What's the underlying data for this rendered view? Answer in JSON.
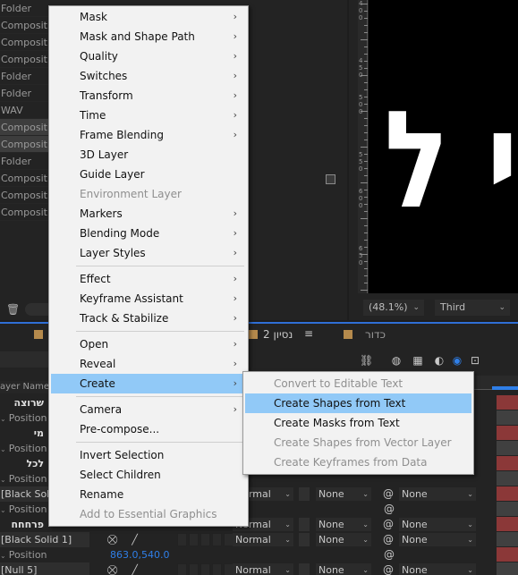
{
  "project": {
    "items": [
      "Folder",
      "Compositio",
      "Compositio",
      "Compositio",
      "Folder",
      "Folder",
      "WAV",
      "Compositio",
      "Compositio",
      "Folder",
      "Compositio",
      "Compositio",
      "Compositio"
    ]
  },
  "viewer": {
    "zoom": "(48.1%)",
    "resolution": "Third",
    "comp_text": "י ל",
    "ruler_numbers": [
      "4",
      "0",
      "0",
      "4",
      "5",
      "0",
      "5",
      "0",
      "0",
      "5",
      "5",
      "0",
      "6",
      "0",
      "0",
      "6",
      "5",
      "0"
    ]
  },
  "timeline": {
    "tabs": [
      "2 נסיון",
      "כדור"
    ],
    "tab_menu": "≡",
    "column_header": "ayer Name",
    "layers": [
      {
        "name": "שרוצה",
        "kind": "text"
      },
      {
        "name": "Position",
        "kind": "prop"
      },
      {
        "name": "מי",
        "kind": "text"
      },
      {
        "name": "Position",
        "kind": "prop"
      },
      {
        "name": "לכל",
        "kind": "text"
      },
      {
        "name": "Position",
        "kind": "prop"
      },
      {
        "name": "[Black Sol",
        "kind": "solid"
      },
      {
        "name": "Position",
        "kind": "prop"
      },
      {
        "name": "פרחחח",
        "kind": "text"
      },
      {
        "name": "[Black Solid 1]",
        "kind": "solid"
      },
      {
        "name": "Position",
        "kind": "prop"
      },
      {
        "name": "[Null 5]",
        "kind": "solid"
      }
    ],
    "position_value": "863.0,540.0",
    "switch_rows": [
      {
        "mode": "Normal",
        "trkmat": "None",
        "parent": "None"
      },
      {
        "mode": "Normal",
        "trkmat": "None",
        "parent": "None"
      },
      {
        "mode": "Normal",
        "trkmat": "None",
        "parent": "None"
      },
      {
        "mode": "Normal",
        "trkmat": "None",
        "parent": "None"
      }
    ]
  },
  "context_menu": {
    "items": [
      {
        "label": "Mask",
        "submenu": true,
        "disabled": false
      },
      {
        "label": "Mask and Shape Path",
        "submenu": true,
        "disabled": false
      },
      {
        "label": "Quality",
        "submenu": true,
        "disabled": false
      },
      {
        "label": "Switches",
        "submenu": true,
        "disabled": false
      },
      {
        "label": "Transform",
        "submenu": true,
        "disabled": false
      },
      {
        "label": "Time",
        "submenu": true,
        "disabled": false
      },
      {
        "label": "Frame Blending",
        "submenu": true,
        "disabled": false
      },
      {
        "label": "3D Layer",
        "submenu": false,
        "disabled": false
      },
      {
        "label": "Guide Layer",
        "submenu": false,
        "disabled": false
      },
      {
        "label": "Environment Layer",
        "submenu": false,
        "disabled": true
      },
      {
        "label": "Markers",
        "submenu": true,
        "disabled": false
      },
      {
        "label": "Blending Mode",
        "submenu": true,
        "disabled": false
      },
      {
        "label": "Layer Styles",
        "submenu": true,
        "disabled": false
      },
      {
        "label": "Effect",
        "submenu": true,
        "disabled": false
      },
      {
        "label": "Keyframe Assistant",
        "submenu": true,
        "disabled": false
      },
      {
        "label": "Track & Stabilize",
        "submenu": true,
        "disabled": false
      },
      {
        "label": "Open",
        "submenu": true,
        "disabled": false
      },
      {
        "label": "Reveal",
        "submenu": true,
        "disabled": false
      },
      {
        "label": "Create",
        "submenu": true,
        "disabled": false,
        "highlighted": true
      },
      {
        "label": "Camera",
        "submenu": true,
        "disabled": false
      },
      {
        "label": "Pre-compose...",
        "submenu": false,
        "disabled": false
      },
      {
        "label": "Invert Selection",
        "submenu": false,
        "disabled": false
      },
      {
        "label": "Select Children",
        "submenu": false,
        "disabled": false
      },
      {
        "label": "Rename",
        "submenu": false,
        "disabled": false
      },
      {
        "label": "Add to Essential Graphics",
        "submenu": false,
        "disabled": true
      }
    ]
  },
  "create_submenu": {
    "items": [
      {
        "label": "Convert to Editable Text",
        "disabled": true
      },
      {
        "label": "Create Shapes from Text",
        "disabled": false,
        "highlighted": true
      },
      {
        "label": "Create Masks from Text",
        "disabled": false
      },
      {
        "label": "Create Shapes from Vector Layer",
        "disabled": true
      },
      {
        "label": "Create Keyframes from Data",
        "disabled": true
      }
    ]
  },
  "colors": {
    "menu_bg": "#f2f2f2",
    "menu_highlight": "#91c9f7",
    "accent_blue": "#2f7fe8",
    "track_red": "#8b3838",
    "tab_label_color": "#b58a4c"
  },
  "icons": {
    "submenu_arrow": "›",
    "trash": "🗑",
    "dropdown": "⌄",
    "spiral": "@"
  }
}
